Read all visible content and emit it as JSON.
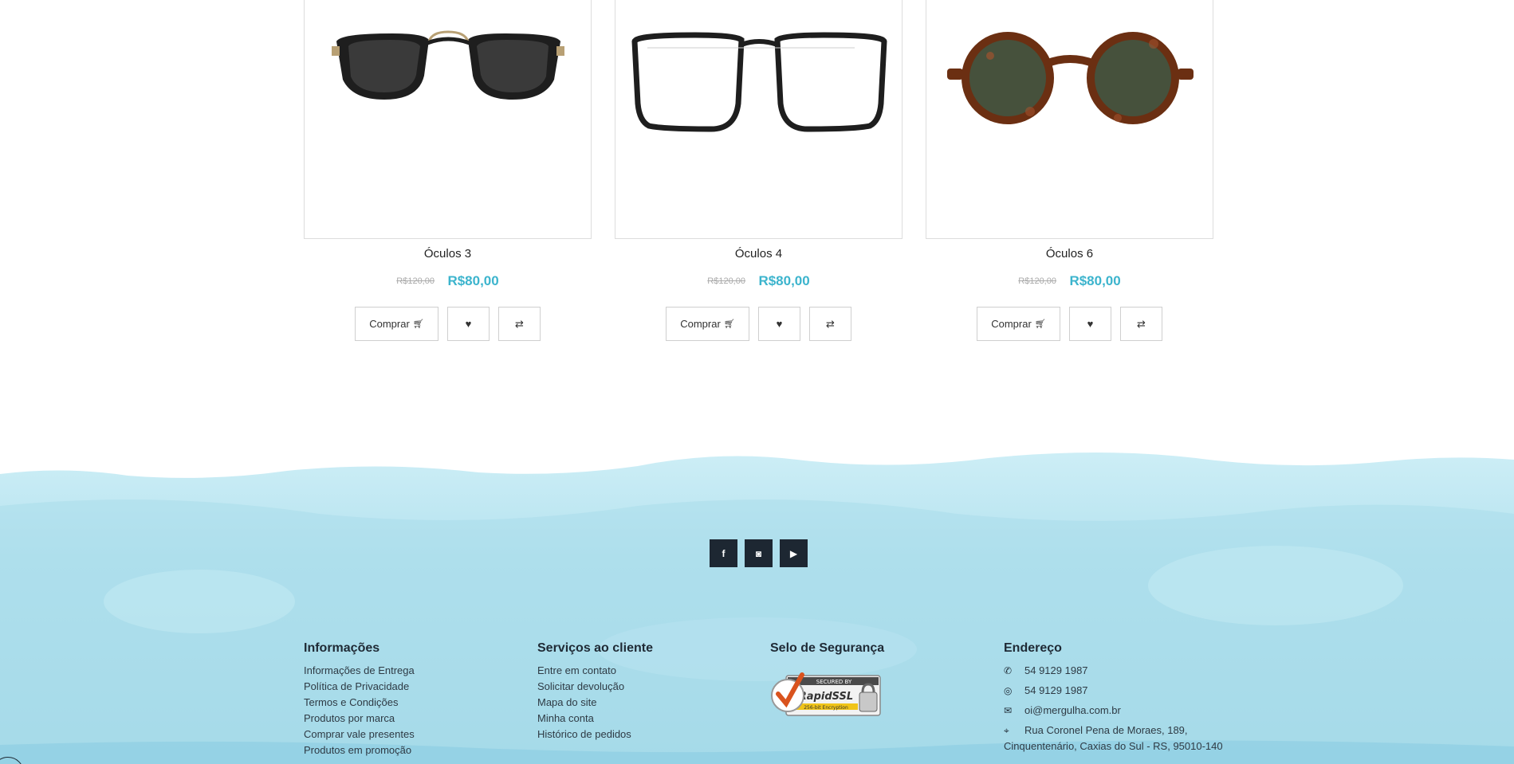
{
  "products": [
    {
      "name": "Óculos 3",
      "old_price": "R$120,00",
      "price": "R$80,00",
      "buy_label": "Comprar",
      "image": "black-sunglasses-gold-bridge"
    },
    {
      "name": "Óculos 4",
      "old_price": "R$120,00",
      "price": "R$80,00",
      "buy_label": "Comprar",
      "image": "black-square-eyeglasses"
    },
    {
      "name": "Óculos 6",
      "old_price": "R$120,00",
      "price": "R$80,00",
      "buy_label": "Comprar",
      "image": "round-tortoise-sunglasses"
    }
  ],
  "icons": {
    "cart": "cart-icon",
    "wishlist": "heart-icon",
    "compare": "exchange-icon"
  },
  "social": [
    {
      "name": "facebook-icon",
      "glyph": "f"
    },
    {
      "name": "instagram-icon",
      "glyph": "◙"
    },
    {
      "name": "youtube-icon",
      "glyph": "▶"
    }
  ],
  "footer": {
    "info": {
      "title": "Informações",
      "links": [
        "Informações de Entrega",
        "Política de Privacidade",
        "Termos e Condições",
        "Produtos por marca",
        "Comprar vale presentes",
        "Produtos em promoção"
      ]
    },
    "service": {
      "title": "Serviços ao cliente",
      "links": [
        "Entre em contato",
        "Solicitar devolução",
        "Mapa do site",
        "Minha conta",
        "Histórico de pedidos"
      ]
    },
    "security": {
      "title": "Selo de Segurança",
      "seal_top": "SECURED BY",
      "seal_brand": "RapidSSL",
      "seal_bottom": "256-bit Encryption"
    },
    "address": {
      "title": "Endereço",
      "phone": "54 9129 1987",
      "whatsapp": "54 9129 1987",
      "email": "oi@mergulha.com.br",
      "street": "Rua Coronel Pena de Moraes, 189,",
      "city": "Cinquentenário, Caxias do Sul - RS, 95010-140"
    }
  },
  "colors": {
    "price": "#3cb4cd",
    "footer_water": "#b4e2ef",
    "social_bg": "#1d2732"
  }
}
